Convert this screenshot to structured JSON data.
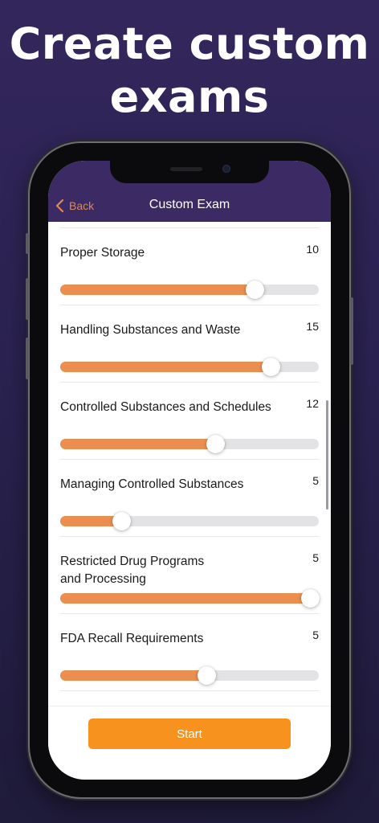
{
  "headline": {
    "line1": "Create custom",
    "line2": "exams"
  },
  "navbar": {
    "back_label": "Back",
    "title": "Custom Exam"
  },
  "topics": [
    {
      "label": "Proper Storage",
      "count": "10",
      "level": 0.75
    },
    {
      "label": "Handling Substances and Waste",
      "count": "15",
      "level": 0.815
    },
    {
      "label": "Controlled Substances and Schedules",
      "count": "12",
      "level": 0.6
    },
    {
      "label": "Managing Controlled Substances",
      "count": "5",
      "level": 0.235
    },
    {
      "label": "Restricted Drug Programs and Processing",
      "count": "5",
      "level": 1.0
    },
    {
      "label": "FDA Recall Requirements",
      "count": "5",
      "level": 0.565
    }
  ],
  "footer": {
    "start_label": "Start"
  },
  "colors": {
    "background": "#2a2250",
    "navbar": "#3b2a63",
    "accent_back": "#d9895a",
    "slider_fill": "#eb8f50",
    "slider_track": "#e3e3e5",
    "start_button": "#f8921f"
  }
}
